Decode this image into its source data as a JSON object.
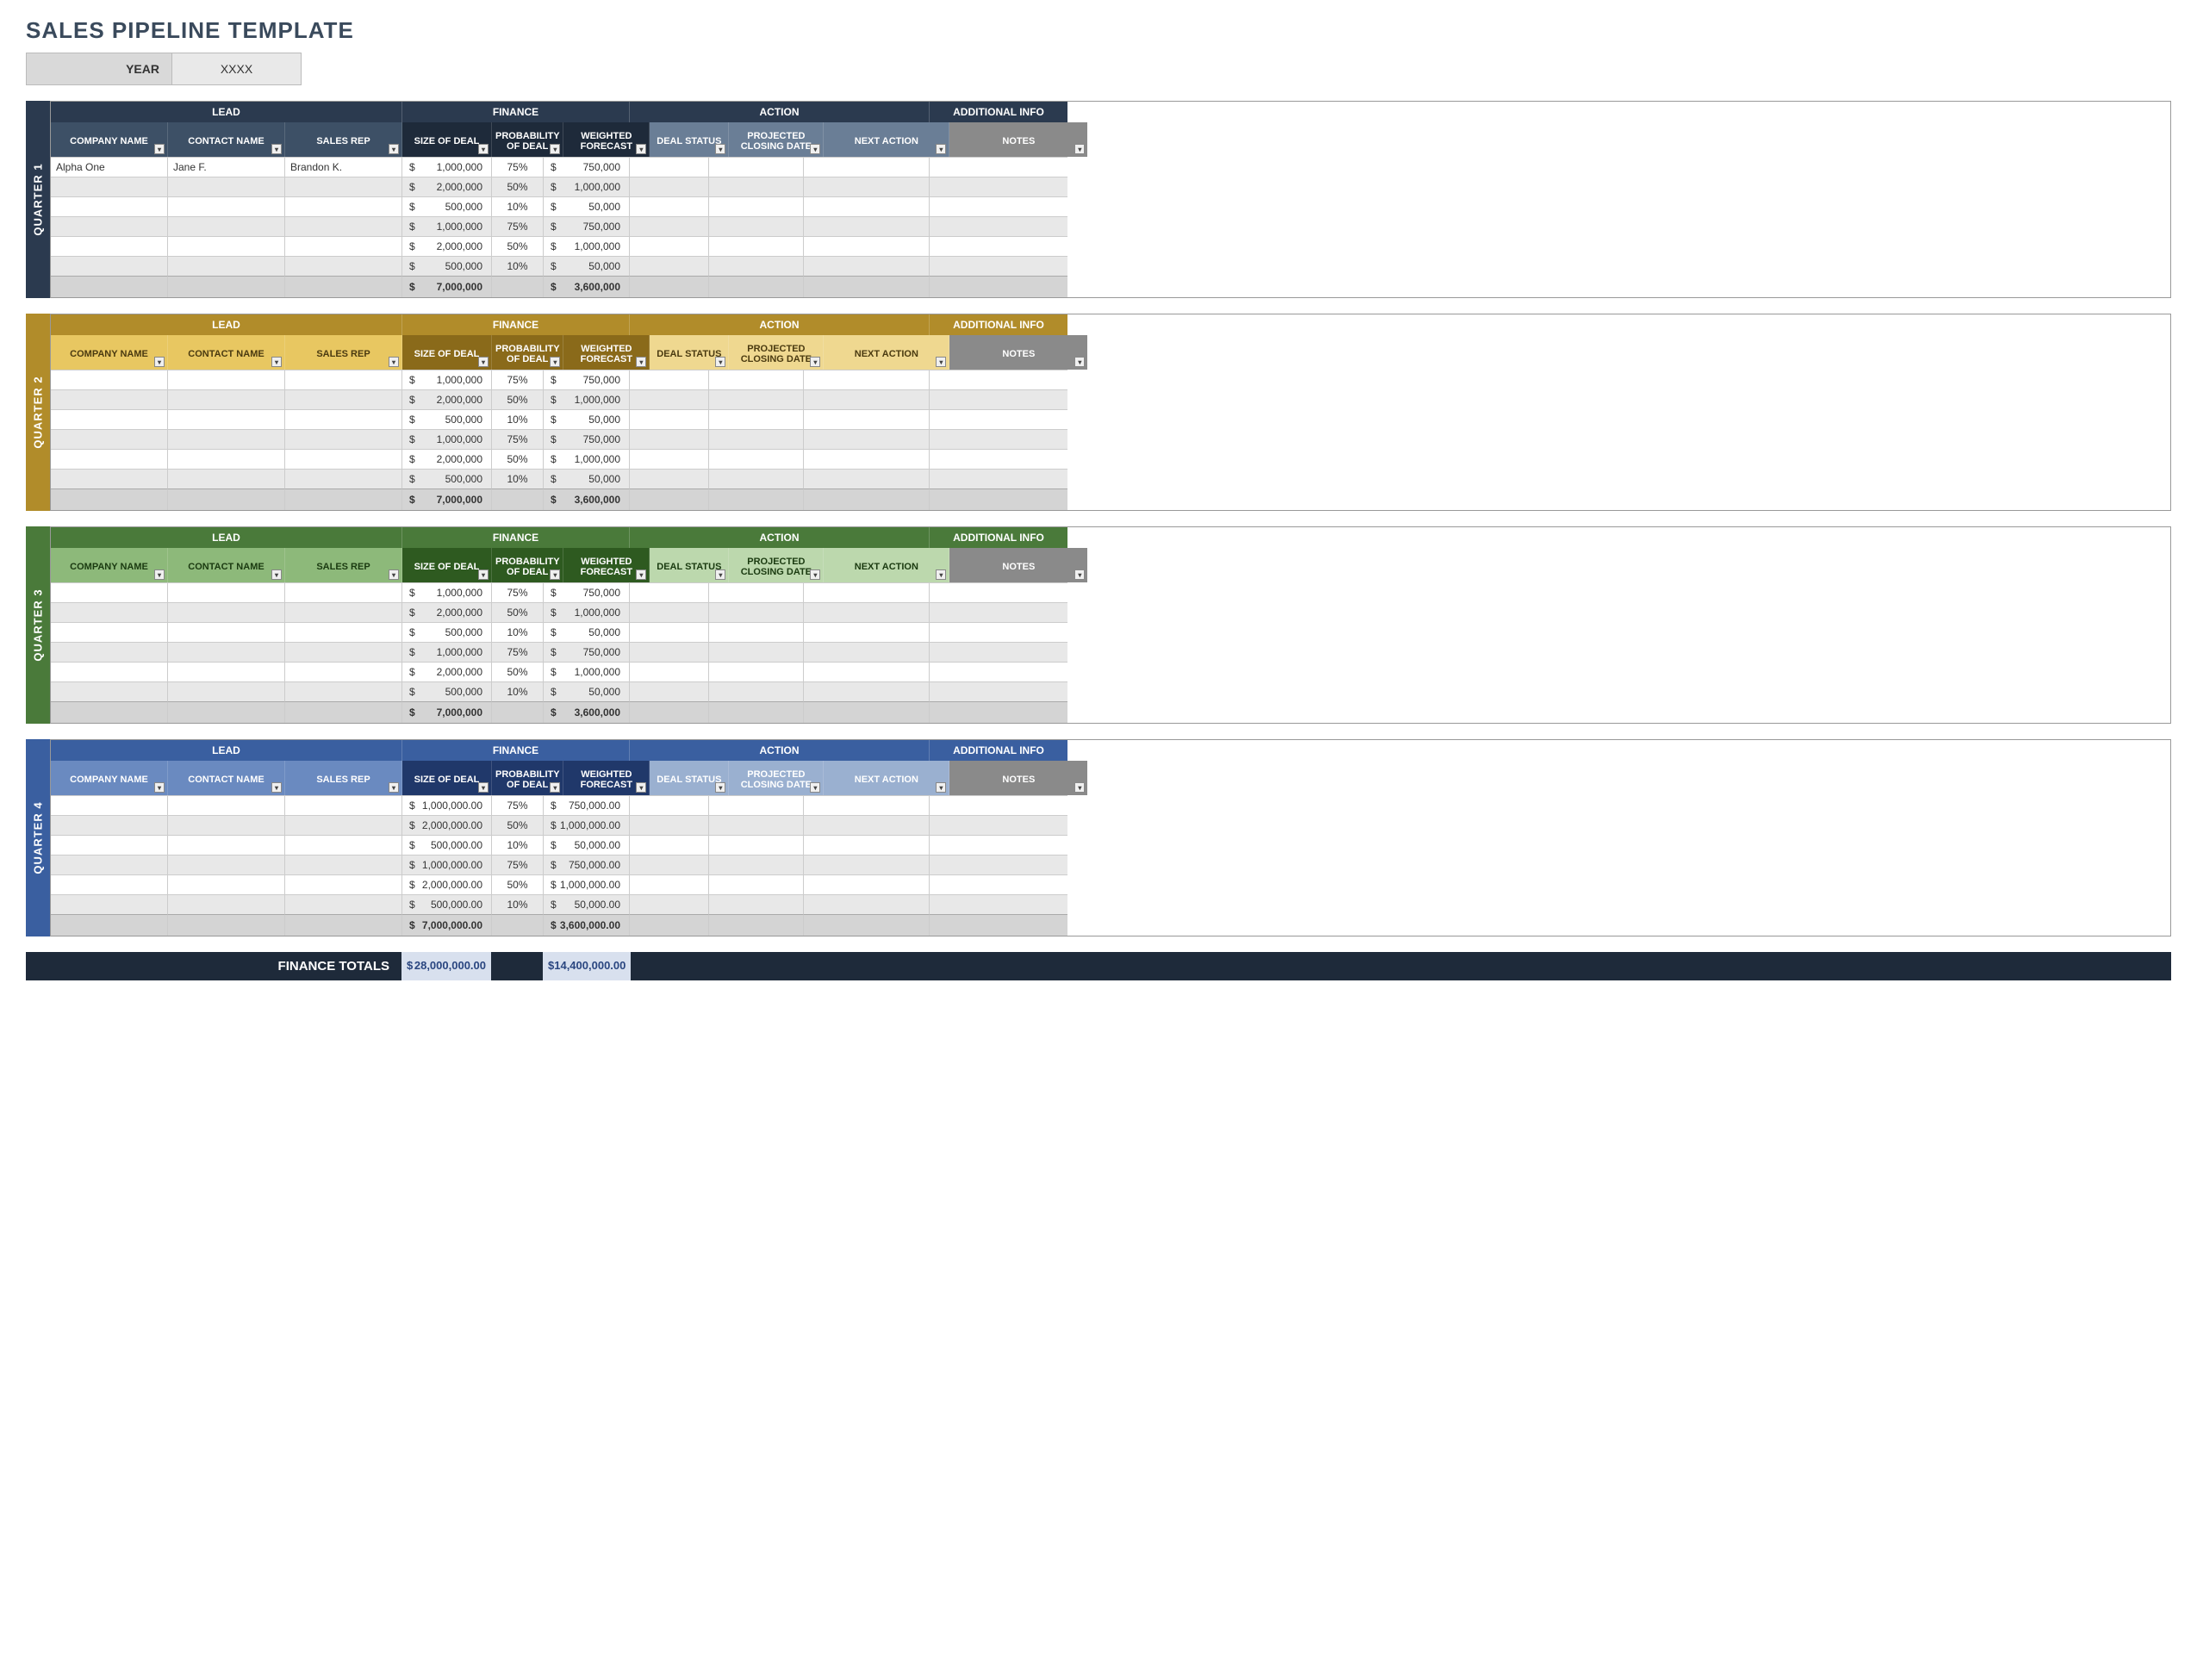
{
  "title": "SALES PIPELINE TEMPLATE",
  "year_label": "YEAR",
  "year_value": "XXXX",
  "sections": {
    "lead": "LEAD",
    "finance": "FINANCE",
    "action": "ACTION",
    "info": "ADDITIONAL INFO"
  },
  "headers": {
    "company": "COMPANY NAME",
    "contact": "CONTACT NAME",
    "rep": "SALES REP",
    "size": "SIZE OF DEAL",
    "prob": "PROBABILITY OF DEAL",
    "forecast": "WEIGHTED FORECAST",
    "status": "DEAL STATUS",
    "closing": "PROJECTED CLOSING DATE",
    "next": "NEXT ACTION",
    "notes": "NOTES"
  },
  "quarters": [
    {
      "name": "QUARTER 1",
      "rows": [
        {
          "company": "Alpha One",
          "contact": "Jane F.",
          "rep": "Brandon K.",
          "size": "1,000,000",
          "prob": "75%",
          "forecast": "750,000"
        },
        {
          "company": "",
          "contact": "",
          "rep": "",
          "size": "2,000,000",
          "prob": "50%",
          "forecast": "1,000,000"
        },
        {
          "company": "",
          "contact": "",
          "rep": "",
          "size": "500,000",
          "prob": "10%",
          "forecast": "50,000"
        },
        {
          "company": "",
          "contact": "",
          "rep": "",
          "size": "1,000,000",
          "prob": "75%",
          "forecast": "750,000"
        },
        {
          "company": "",
          "contact": "",
          "rep": "",
          "size": "2,000,000",
          "prob": "50%",
          "forecast": "1,000,000"
        },
        {
          "company": "",
          "contact": "",
          "rep": "",
          "size": "500,000",
          "prob": "10%",
          "forecast": "50,000"
        }
      ],
      "total_size": "7,000,000",
      "total_forecast": "3,600,000"
    },
    {
      "name": "QUARTER 2",
      "rows": [
        {
          "company": "",
          "contact": "",
          "rep": "",
          "size": "1,000,000",
          "prob": "75%",
          "forecast": "750,000"
        },
        {
          "company": "",
          "contact": "",
          "rep": "",
          "size": "2,000,000",
          "prob": "50%",
          "forecast": "1,000,000"
        },
        {
          "company": "",
          "contact": "",
          "rep": "",
          "size": "500,000",
          "prob": "10%",
          "forecast": "50,000"
        },
        {
          "company": "",
          "contact": "",
          "rep": "",
          "size": "1,000,000",
          "prob": "75%",
          "forecast": "750,000"
        },
        {
          "company": "",
          "contact": "",
          "rep": "",
          "size": "2,000,000",
          "prob": "50%",
          "forecast": "1,000,000"
        },
        {
          "company": "",
          "contact": "",
          "rep": "",
          "size": "500,000",
          "prob": "10%",
          "forecast": "50,000"
        }
      ],
      "total_size": "7,000,000",
      "total_forecast": "3,600,000"
    },
    {
      "name": "QUARTER 3",
      "rows": [
        {
          "company": "",
          "contact": "",
          "rep": "",
          "size": "1,000,000",
          "prob": "75%",
          "forecast": "750,000"
        },
        {
          "company": "",
          "contact": "",
          "rep": "",
          "size": "2,000,000",
          "prob": "50%",
          "forecast": "1,000,000"
        },
        {
          "company": "",
          "contact": "",
          "rep": "",
          "size": "500,000",
          "prob": "10%",
          "forecast": "50,000"
        },
        {
          "company": "",
          "contact": "",
          "rep": "",
          "size": "1,000,000",
          "prob": "75%",
          "forecast": "750,000"
        },
        {
          "company": "",
          "contact": "",
          "rep": "",
          "size": "2,000,000",
          "prob": "50%",
          "forecast": "1,000,000"
        },
        {
          "company": "",
          "contact": "",
          "rep": "",
          "size": "500,000",
          "prob": "10%",
          "forecast": "50,000"
        }
      ],
      "total_size": "7,000,000",
      "total_forecast": "3,600,000"
    },
    {
      "name": "QUARTER 4",
      "rows": [
        {
          "company": "",
          "contact": "",
          "rep": "",
          "size": "1,000,000.00",
          "prob": "75%",
          "forecast": "750,000.00"
        },
        {
          "company": "",
          "contact": "",
          "rep": "",
          "size": "2,000,000.00",
          "prob": "50%",
          "forecast": "1,000,000.00"
        },
        {
          "company": "",
          "contact": "",
          "rep": "",
          "size": "500,000.00",
          "prob": "10%",
          "forecast": "50,000.00"
        },
        {
          "company": "",
          "contact": "",
          "rep": "",
          "size": "1,000,000.00",
          "prob": "75%",
          "forecast": "750,000.00"
        },
        {
          "company": "",
          "contact": "",
          "rep": "",
          "size": "2,000,000.00",
          "prob": "50%",
          "forecast": "1,000,000.00"
        },
        {
          "company": "",
          "contact": "",
          "rep": "",
          "size": "500,000.00",
          "prob": "10%",
          "forecast": "50,000.00"
        }
      ],
      "total_size": "7,000,000.00",
      "total_forecast": "3,600,000.00"
    }
  ],
  "grand_label": "FINANCE TOTALS",
  "grand_size": "28,000,000.00",
  "grand_forecast": "14,400,000.00"
}
